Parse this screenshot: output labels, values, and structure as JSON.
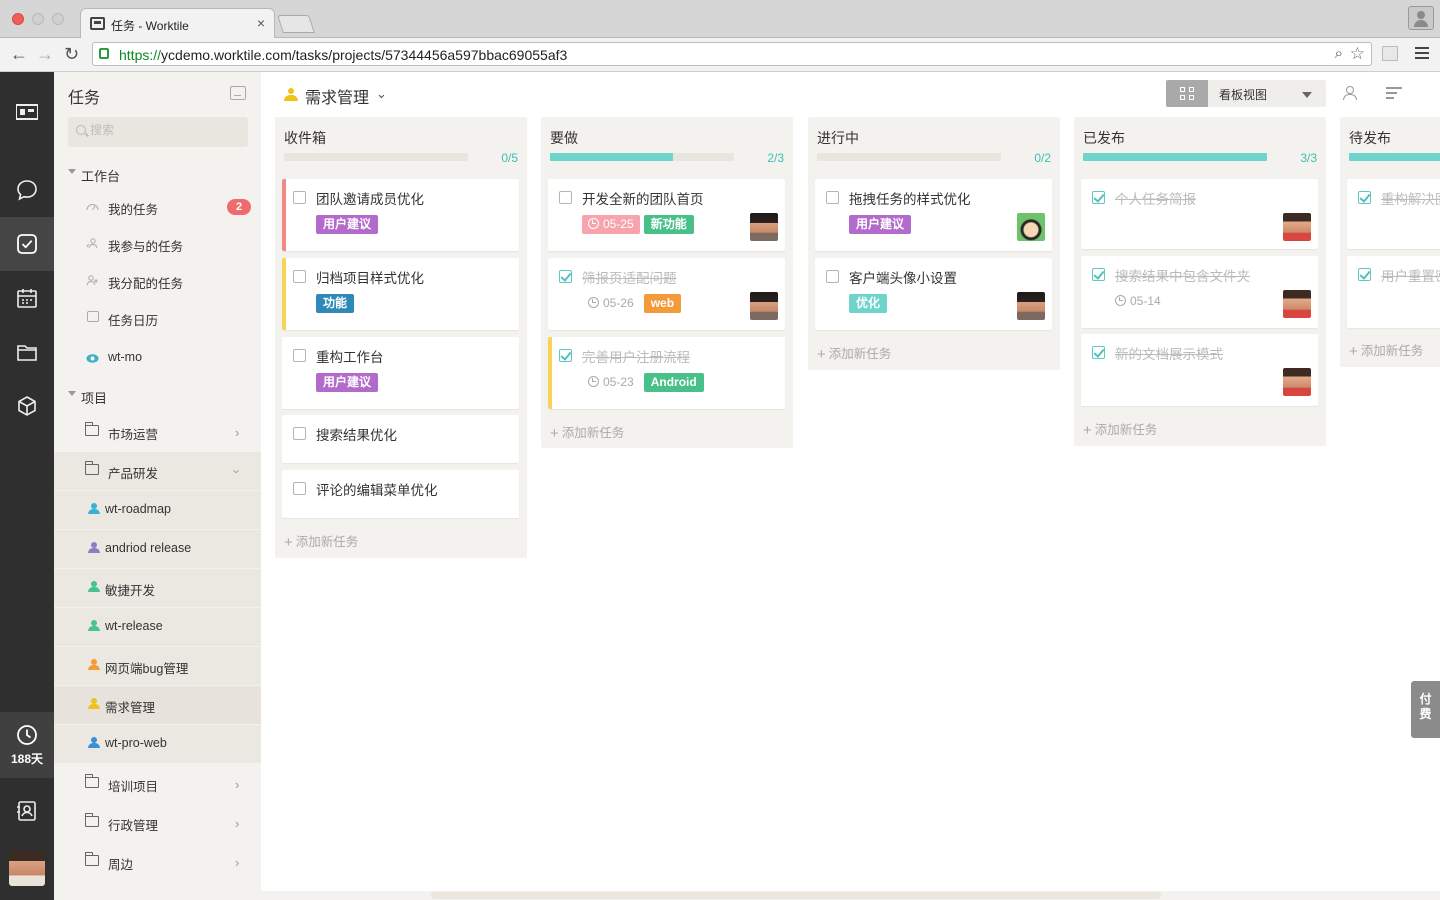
{
  "browser": {
    "tab_title": "任务 - Worktile",
    "url_scheme": "https://",
    "url_rest": "ycdemo.worktile.com/tasks/projects/57344456a597bbac69055af3"
  },
  "rail": {
    "timer_days": "188天",
    "icons": [
      "logo-icon",
      "chat-icon",
      "tasks-icon",
      "calendar-icon",
      "folder-icon",
      "box-icon",
      "clock-icon",
      "contacts-icon"
    ]
  },
  "sidebar": {
    "title": "任务",
    "search_placeholder": "搜索",
    "workbench_label": "工作台",
    "workbench_items": [
      {
        "label": "我的任务",
        "badge": "2"
      },
      {
        "label": "我参与的任务"
      },
      {
        "label": "我分配的任务"
      },
      {
        "label": "任务日历"
      },
      {
        "label": "wt-mo"
      }
    ],
    "projects_label": "项目",
    "project_items": [
      {
        "label": "市场运营",
        "type": "folder"
      },
      {
        "label": "产品研发",
        "type": "folder-open"
      },
      {
        "label": "wt-roadmap",
        "color": "#3bb0d6"
      },
      {
        "label": "andriod release",
        "color": "#8e7cc3"
      },
      {
        "label": "敏捷开发",
        "color": "#49c191"
      },
      {
        "label": "wt-release",
        "color": "#49c191"
      },
      {
        "label": "网页端bug管理",
        "color": "#f39c3a"
      },
      {
        "label": "需求管理",
        "color": "#f1c21b"
      },
      {
        "label": "wt-pro-web",
        "color": "#3b8fd6"
      },
      {
        "label": "培训项目",
        "type": "folder"
      },
      {
        "label": "行政管理",
        "type": "folder"
      },
      {
        "label": "周边",
        "type": "folder"
      }
    ]
  },
  "header": {
    "project_name": "需求管理",
    "view_label": "看板视图"
  },
  "columns": [
    {
      "title": "收件箱",
      "count": "0/5",
      "progress": 0,
      "add_label": "添加新任务",
      "cards": [
        {
          "title": "团队邀请成员优化",
          "stripe": "#f08a85",
          "tags": [
            {
              "text": "用户建议",
              "color": "#b36bcb"
            }
          ]
        },
        {
          "title": "归档项目样式优化",
          "stripe": "#f7d356",
          "tags": [
            {
              "text": "功能",
              "color": "#2f89b8"
            }
          ]
        },
        {
          "title": "重构工作台",
          "tags": [
            {
              "text": "用户建议",
              "color": "#b36bcb"
            }
          ]
        },
        {
          "title": "搜索结果优化"
        },
        {
          "title": "评论的编辑菜单优化"
        }
      ]
    },
    {
      "title": "要做",
      "count": "2/3",
      "progress": 0.667,
      "add_label": "添加新任务",
      "cards": [
        {
          "title": "开发全新的团队首页",
          "date": "05-25",
          "due": true,
          "tags": [
            {
              "text": "新功能",
              "color": "#49c08a"
            }
          ],
          "avatar": "man"
        },
        {
          "title": "筛报页适配问题",
          "done": true,
          "date": "05-26",
          "tags": [
            {
              "text": "web",
              "color": "#f39a3a"
            }
          ],
          "avatar": "man"
        },
        {
          "title": "完善用户注册流程",
          "done": true,
          "stripe": "#f7d356",
          "date": "05-23",
          "tags": [
            {
              "text": "Android",
              "color": "#49c08a"
            }
          ]
        }
      ]
    },
    {
      "title": "进行中",
      "count": "0/2",
      "progress": 0,
      "add_label": "添加新任务",
      "cards": [
        {
          "title": "拖拽任务的样式优化",
          "tags": [
            {
              "text": "用户建议",
              "color": "#b36bcb"
            }
          ],
          "avatar": "cartoon"
        },
        {
          "title": "客户端头像小设置",
          "tags": [
            {
              "text": "优化",
              "color": "#6fd4cc"
            }
          ],
          "avatar": "man"
        }
      ]
    },
    {
      "title": "已发布",
      "count": "3/3",
      "progress": 1,
      "add_label": "添加新任务",
      "cards": [
        {
          "title": "个人任务简报",
          "done": true,
          "avatar": "red"
        },
        {
          "title": "搜索结果中包含文件夹",
          "done": true,
          "date": "05-14",
          "avatar": "red"
        },
        {
          "title": "新的文档展示模式",
          "done": true,
          "avatar": "red"
        }
      ]
    },
    {
      "title": "待发布",
      "count": "",
      "progress": 1,
      "add_label": "添加新任务",
      "cards": [
        {
          "title": "重构解决图",
          "done": true
        },
        {
          "title": "用户重置密",
          "done": true
        }
      ]
    }
  ],
  "pay_button": "付费"
}
